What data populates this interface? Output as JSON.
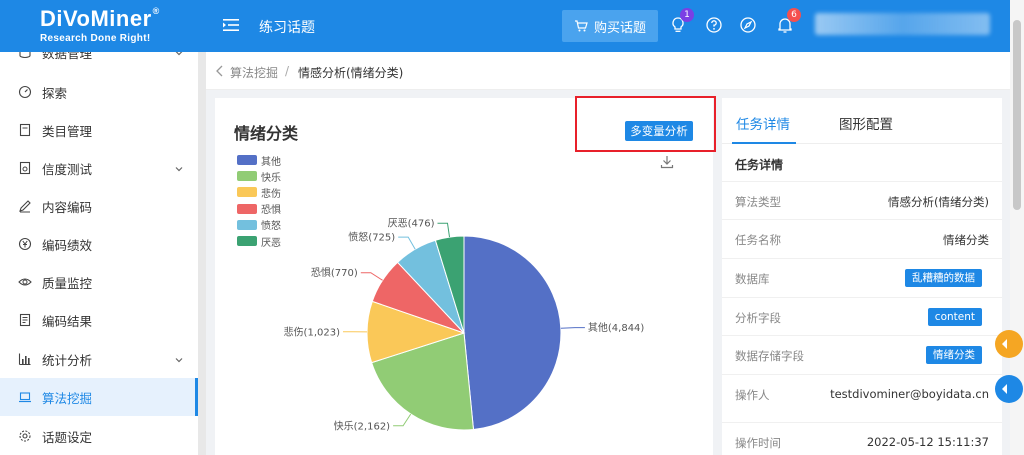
{
  "topbar": {
    "logo_main": "DiVoMiner",
    "logo_reg": "®",
    "logo_sub": "Research Done Right!",
    "page_name": "练习话题",
    "buy_label": "购买话题",
    "bulb_badge": "1",
    "bell_badge": "6",
    "icons": [
      "menu-icon",
      "cart-icon",
      "bulb-icon",
      "help-icon",
      "compass-icon",
      "bell-icon"
    ]
  },
  "sidebar": {
    "items": [
      {
        "label": "数据管理",
        "icon": "database-icon",
        "chevron": true
      },
      {
        "label": "探索",
        "icon": "dashboard-icon",
        "chevron": false
      },
      {
        "label": "类目管理",
        "icon": "document-icon",
        "chevron": false
      },
      {
        "label": "信度测试",
        "icon": "test-icon",
        "chevron": true
      },
      {
        "label": "内容编码",
        "icon": "pen-icon",
        "chevron": false
      },
      {
        "label": "编码绩效",
        "icon": "yen-icon",
        "chevron": false
      },
      {
        "label": "质量监控",
        "icon": "eye-icon",
        "chevron": false
      },
      {
        "label": "编码结果",
        "icon": "report-icon",
        "chevron": false
      },
      {
        "label": "统计分析",
        "icon": "bar-chart-icon",
        "chevron": true
      },
      {
        "label": "算法挖掘",
        "icon": "laptop-icon",
        "chevron": false,
        "active": true
      },
      {
        "label": "话题设定",
        "icon": "gear-icon",
        "chevron": false
      }
    ]
  },
  "breadcrumb": {
    "parent": "算法挖掘",
    "separator": "/",
    "current": "情感分析(情绪分类)"
  },
  "card": {
    "title": "情绪分类",
    "multi_button": "多变量分析"
  },
  "chart_data": {
    "type": "pie",
    "title": "情绪分类",
    "legend_position": "top-left",
    "categories": [
      "其他",
      "快乐",
      "悲伤",
      "恐惧",
      "愤怒",
      "厌恶"
    ],
    "values": [
      4844,
      2162,
      1023,
      770,
      725,
      476
    ],
    "slice_labels": [
      "其他(4,844)",
      "快乐(2,162)",
      "悲伤(1,023)",
      "恐惧(770)",
      "愤怒(725)",
      "厌恶(476)"
    ],
    "colors": [
      "#5470c6",
      "#91cc75",
      "#fac858",
      "#ee6666",
      "#73c0de",
      "#3ba272"
    ]
  },
  "panel": {
    "tab_details": "任务详情",
    "tab_config": "图形配置",
    "heading": "任务详情",
    "rows": [
      {
        "key": "算法类型",
        "value": "情感分析(情绪分类)",
        "tag": false
      },
      {
        "key": "任务名称",
        "value": "情绪分类",
        "tag": false
      },
      {
        "key": "数据库",
        "value": "乱糟糟的数据",
        "tag": true
      },
      {
        "key": "分析字段",
        "value": "content",
        "tag": true
      },
      {
        "key": "数据存储字段",
        "value": "情绪分类",
        "tag": true
      },
      {
        "key": "操作人",
        "value": "testdivominer@boyidata.cn",
        "tag": false
      },
      {
        "key": "操作时间",
        "value": "2022-05-12 15:11:37",
        "tag": false
      }
    ]
  },
  "colors": {
    "primary": "#1e88e5",
    "highlight": "#e8202a",
    "handle_orange": "#f5a623",
    "handle_blue": "#1e88e5"
  }
}
